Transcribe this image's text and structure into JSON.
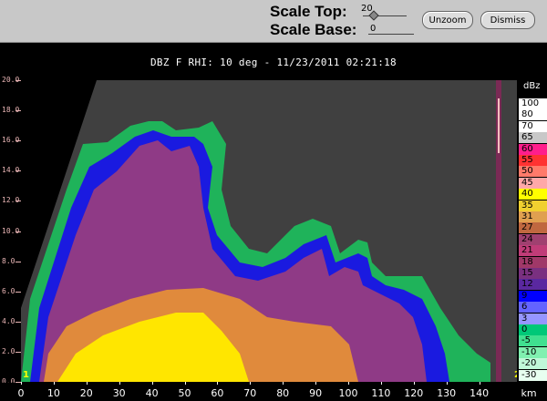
{
  "toolbar": {
    "scale_top_label": "Scale Top:",
    "scale_top_value": "20",
    "scale_base_label": "Scale Base:",
    "scale_base_value": "0",
    "unzoom_label": "Unzoom",
    "dismiss_label": "Dismiss"
  },
  "plot": {
    "title": "DBZ F  RHI: 10 deg  -  11/23/2011 02:21:18",
    "y_ticks": [
      "20.0",
      "18.0",
      "16.0",
      "14.0",
      "12.0",
      "10.0",
      "8.0",
      "6.0",
      "4.0",
      "2.0",
      "0.0"
    ],
    "x_ticks": [
      "0",
      "10",
      "20",
      "30",
      "40",
      "50",
      "60",
      "70",
      "80",
      "90",
      "100",
      "110",
      "120",
      "130",
      "140"
    ],
    "x_unit": "km",
    "marker_left": "1",
    "marker_right": "2"
  },
  "colorbar": {
    "unit": "dBz",
    "levels": [
      {
        "label": "100",
        "color": "#ffffff"
      },
      {
        "label": "80",
        "color": "#ffffff"
      },
      {
        "label": "70",
        "color": "#ffffff"
      },
      {
        "label": "65",
        "color": "#c8c8c8"
      },
      {
        "label": "60",
        "color": "#ff1e8c"
      },
      {
        "label": "55",
        "color": "#ff3232"
      },
      {
        "label": "50",
        "color": "#ff7a6a"
      },
      {
        "label": "45",
        "color": "#ffa8a8"
      },
      {
        "label": "40",
        "color": "#ffff00"
      },
      {
        "label": "35",
        "color": "#f0d030"
      },
      {
        "label": "31",
        "color": "#e0a050"
      },
      {
        "label": "27",
        "color": "#c06840"
      },
      {
        "label": "24",
        "color": "#a04070"
      },
      {
        "label": "21",
        "color": "#c03c78"
      },
      {
        "label": "18",
        "color": "#a03868"
      },
      {
        "label": "15",
        "color": "#7a3080"
      },
      {
        "label": "12",
        "color": "#5a28a0"
      },
      {
        "label": "9",
        "color": "#0000ff"
      },
      {
        "label": "6",
        "color": "#6464ff"
      },
      {
        "label": "3",
        "color": "#9696ff"
      },
      {
        "label": "0",
        "color": "#00c878"
      },
      {
        "label": "-5",
        "color": "#40e090"
      },
      {
        "label": "-10",
        "color": "#80f0b0"
      },
      {
        "label": "-20",
        "color": "#c0f8d8"
      },
      {
        "label": "-30",
        "color": "#e8fff0"
      }
    ]
  }
}
